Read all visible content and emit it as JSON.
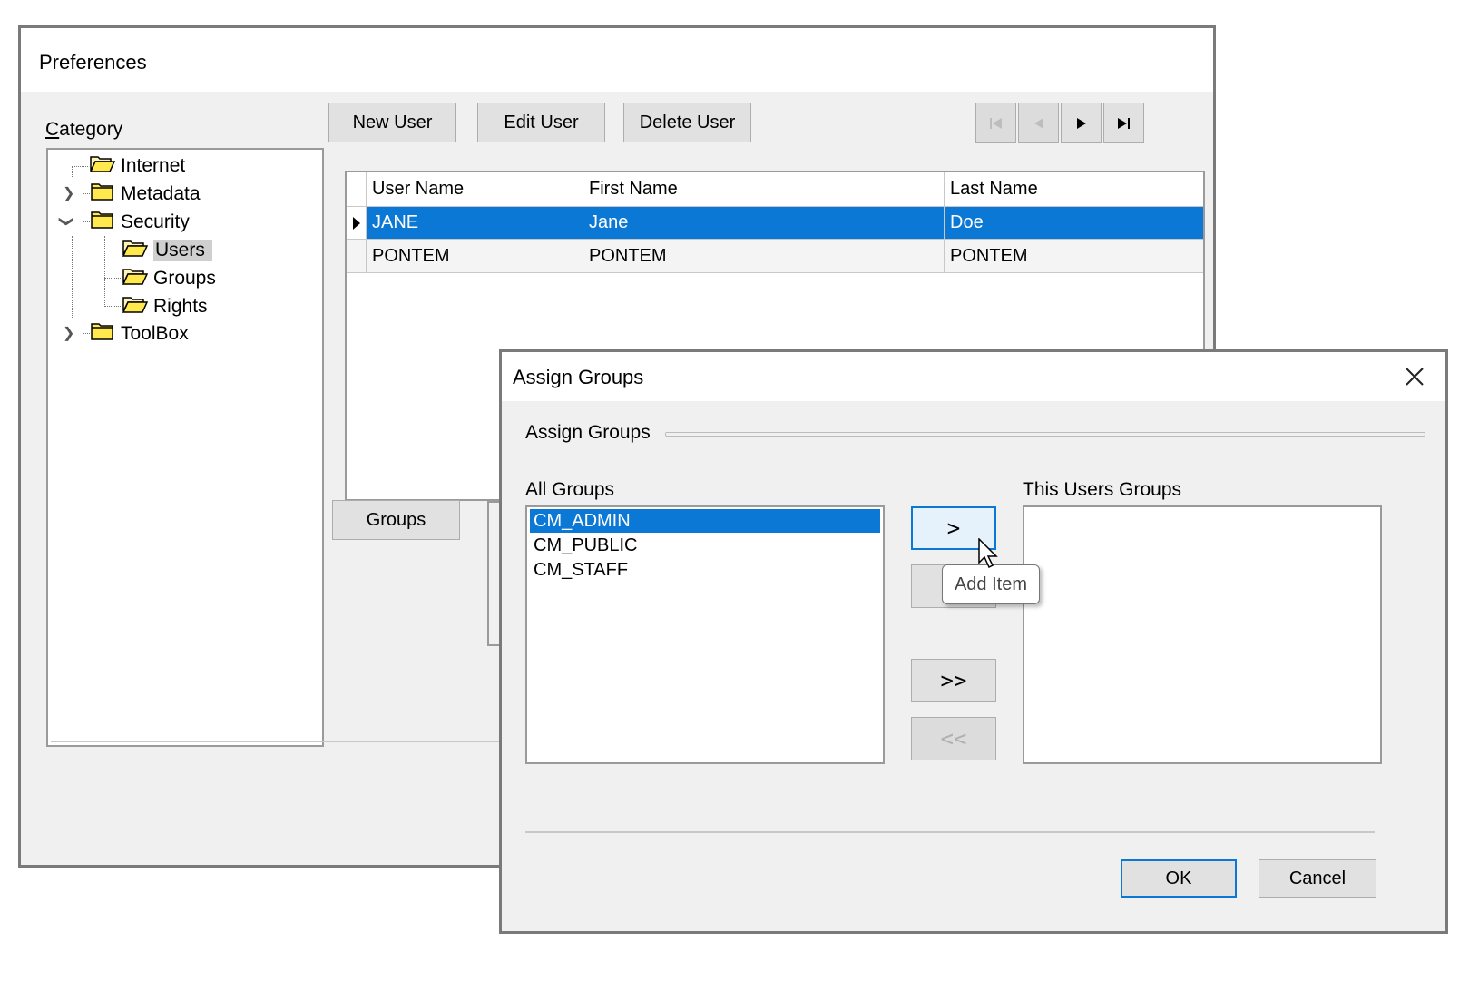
{
  "preferences": {
    "title": "Preferences",
    "category_label_first": "C",
    "category_label_rest": "ategory",
    "tree": [
      {
        "label": "Internet",
        "icon": "open-folder-icon"
      },
      {
        "label": "Metadata",
        "icon": "folder-icon",
        "expander": "collapsed"
      },
      {
        "label": "Security",
        "icon": "folder-icon",
        "expander": "expanded"
      },
      {
        "label": "Users",
        "icon": "open-folder-icon",
        "selected": true
      },
      {
        "label": "Groups",
        "icon": "open-folder-icon"
      },
      {
        "label": "Rights",
        "icon": "open-folder-icon"
      },
      {
        "label": "ToolBox",
        "icon": "folder-icon",
        "expander": "collapsed"
      }
    ],
    "toolbar": {
      "new_user": "New User",
      "edit_user": "Edit User",
      "delete_user": "Delete User"
    },
    "nav_icons": [
      "first-record-icon",
      "previous-record-icon",
      "next-record-icon",
      "last-record-icon"
    ],
    "grid": {
      "columns": [
        "User Name",
        "First Name",
        "Last Name"
      ],
      "rows": [
        [
          "JANE",
          "Jane",
          "Doe"
        ],
        [
          "PONTEM",
          "PONTEM",
          "PONTEM"
        ]
      ],
      "selected_row": 0
    },
    "groups_button": "Groups"
  },
  "assign_dialog": {
    "title": "Assign Groups",
    "group_caption": "Assign Groups",
    "all_groups_label": "All Groups",
    "this_users_groups_label": "This Users Groups",
    "all_groups": [
      "CM_ADMIN",
      "CM_PUBLIC",
      "CM_STAFF"
    ],
    "this_users_groups": [],
    "buttons": {
      "add": ">",
      "remove": "<",
      "add_all": ">>",
      "remove_all": "<<",
      "ok": "OK",
      "cancel": "Cancel"
    },
    "tooltip": "Add Item",
    "accent_color": "#0a78d4"
  }
}
